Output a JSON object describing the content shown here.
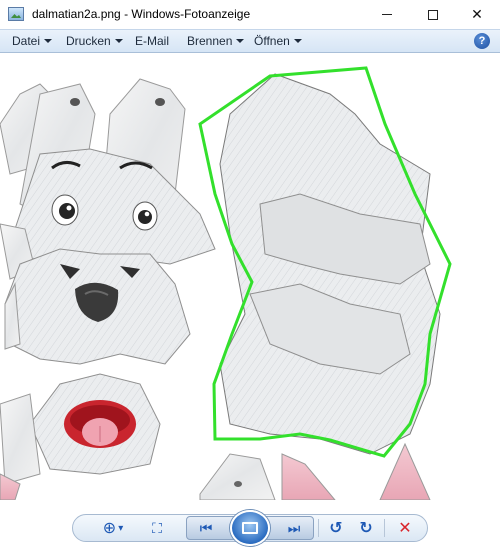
{
  "window": {
    "title": "dalmatian2a.png - Windows-Fotoanzeige",
    "minimize_icon": "minimize-icon",
    "maximize_icon": "maximize-icon",
    "close_glyph": "✕"
  },
  "menu": {
    "items": [
      {
        "label": "Datei",
        "has_dropdown": true
      },
      {
        "label": "Drucken",
        "has_dropdown": true
      },
      {
        "label": "E-Mail",
        "has_dropdown": false
      },
      {
        "label": "Brennen",
        "has_dropdown": true
      },
      {
        "label": "Öffnen",
        "has_dropdown": true
      }
    ],
    "help_glyph": "?"
  },
  "image": {
    "description_icon": "papercraft-template-image",
    "highlight_color": "#33e02c"
  },
  "toolbar": {
    "zoom_glyph": "⊕",
    "zoom_caret": "▾",
    "fit_glyph": "⛶",
    "prev_glyph": "⏮",
    "next_glyph": "⏭",
    "rotate_left_glyph": "↺",
    "rotate_right_glyph": "↻",
    "delete_glyph": "✕",
    "accent": "#1e59b5",
    "delete_color": "#d9262c"
  }
}
